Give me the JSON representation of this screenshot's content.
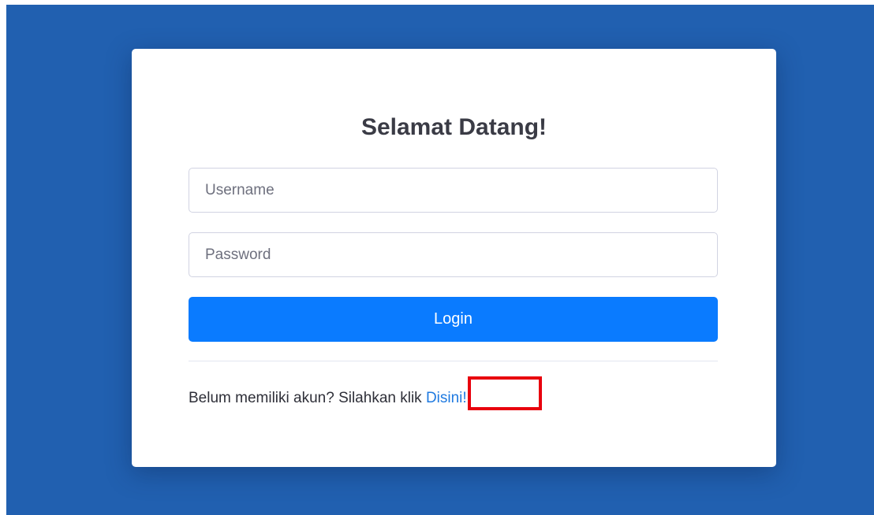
{
  "login": {
    "title": "Selamat Datang!",
    "username_placeholder": "Username",
    "username_value": "",
    "password_placeholder": "Password",
    "password_value": "",
    "login_label": "Login",
    "register_prompt": "Belum memiliki akun? Silahkan klik ",
    "register_link": "Disini!"
  },
  "colors": {
    "background": "#2160b0",
    "primary_button": "#0a7bff",
    "link": "#1f7ae0",
    "highlight": "#e8000d"
  }
}
